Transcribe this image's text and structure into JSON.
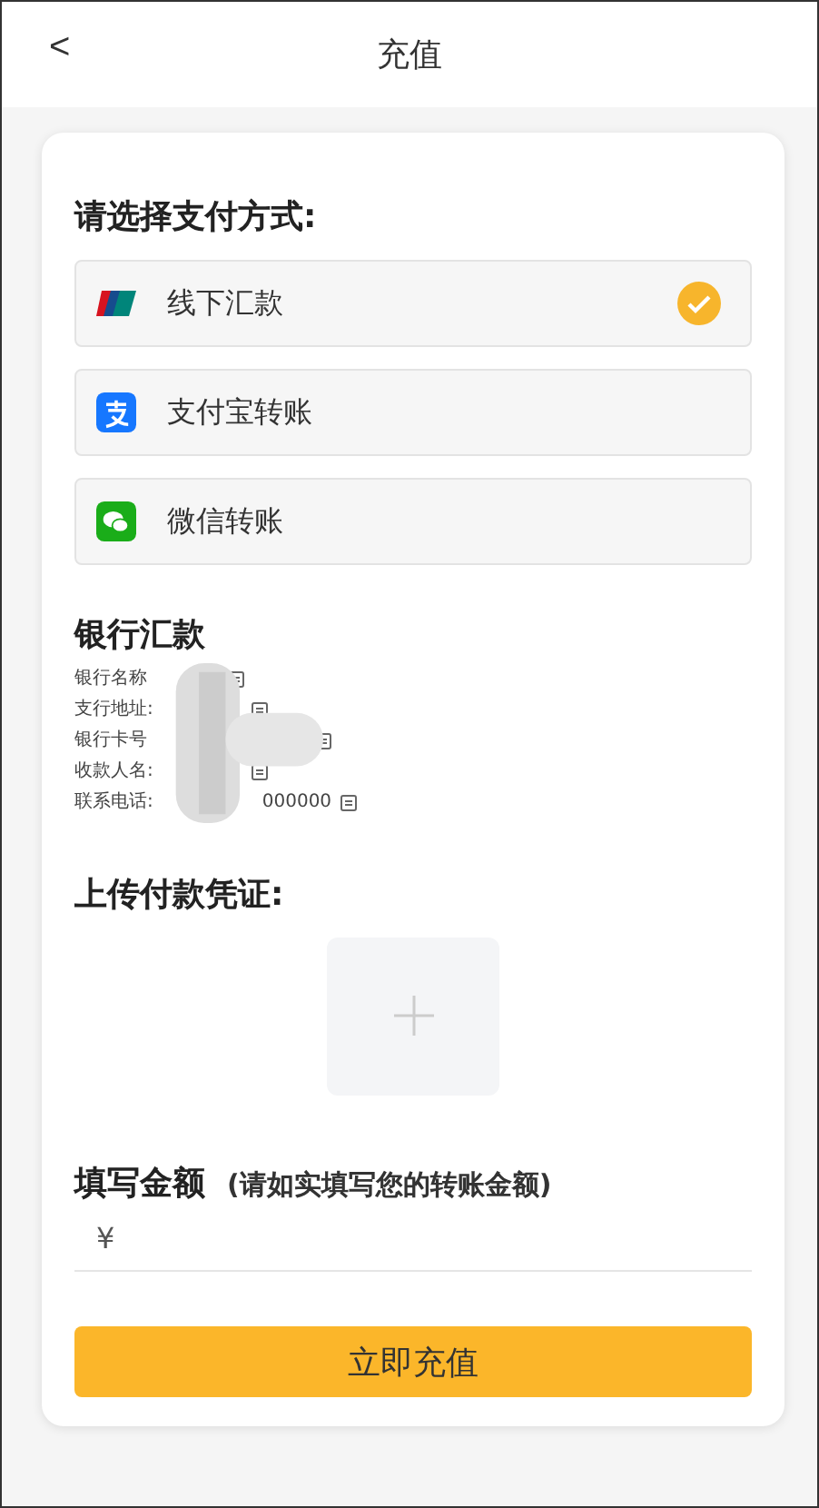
{
  "header": {
    "back": "<",
    "title": "充值"
  },
  "payment": {
    "heading": "请选择支付方式:",
    "methods": [
      {
        "kind": "unionpay",
        "label": "线下汇款",
        "selected": true
      },
      {
        "kind": "alipay",
        "label": "支付宝转账",
        "selected": false
      },
      {
        "kind": "wechat",
        "label": "微信转账",
        "selected": false
      }
    ]
  },
  "bank": {
    "heading": "银行汇款",
    "rows": [
      {
        "label": "银行名称"
      },
      {
        "label": "支行地址:"
      },
      {
        "label": "银行卡号"
      },
      {
        "label": "收款人名:"
      },
      {
        "label": "联系电话:",
        "value": "000000"
      }
    ]
  },
  "upload": {
    "heading": "上传付款凭证:"
  },
  "amount": {
    "heading": "填写金额",
    "hint": "(请如实填写您的转账金额)",
    "currency": "¥"
  },
  "submit": "立即充值"
}
